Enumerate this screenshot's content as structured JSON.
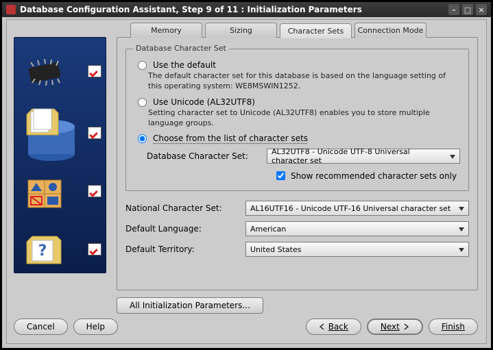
{
  "window": {
    "title": "Database Configuration Assistant, Step 9 of 11 : Initialization Parameters"
  },
  "tabs": {
    "memory": "Memory",
    "sizing": "Sizing",
    "charsets": "Character Sets",
    "connmode": "Connection Mode"
  },
  "fieldset": {
    "legend": "Database Character Set",
    "opt_default_label": "Use the default",
    "opt_default_desc": "The default character set for this database is based on the language setting of this operating system: WE8MSWIN1252.",
    "opt_unicode_label": "Use Unicode (AL32UTF8)",
    "opt_unicode_desc": "Setting character set to Unicode (AL32UTF8) enables you to store multiple language groups.",
    "opt_choose_label": "Choose from the list of character sets",
    "db_charset_label": "Database Character Set:",
    "db_charset_value": "AL32UTF8 - Unicode UTF-8 Universal character set",
    "show_rec_label": "Show recommended character sets only"
  },
  "national": {
    "label": "National Character Set:",
    "value": "AL16UTF16 - Unicode UTF-16 Universal character set"
  },
  "lang": {
    "label": "Default Language:",
    "value": "American"
  },
  "territory": {
    "label": "Default Territory:",
    "value": "United States"
  },
  "all_params": "All Initialization Parameters...",
  "buttons": {
    "cancel": "Cancel",
    "help": "Help",
    "back": "Back",
    "next": "Next",
    "finish": "Finish"
  }
}
